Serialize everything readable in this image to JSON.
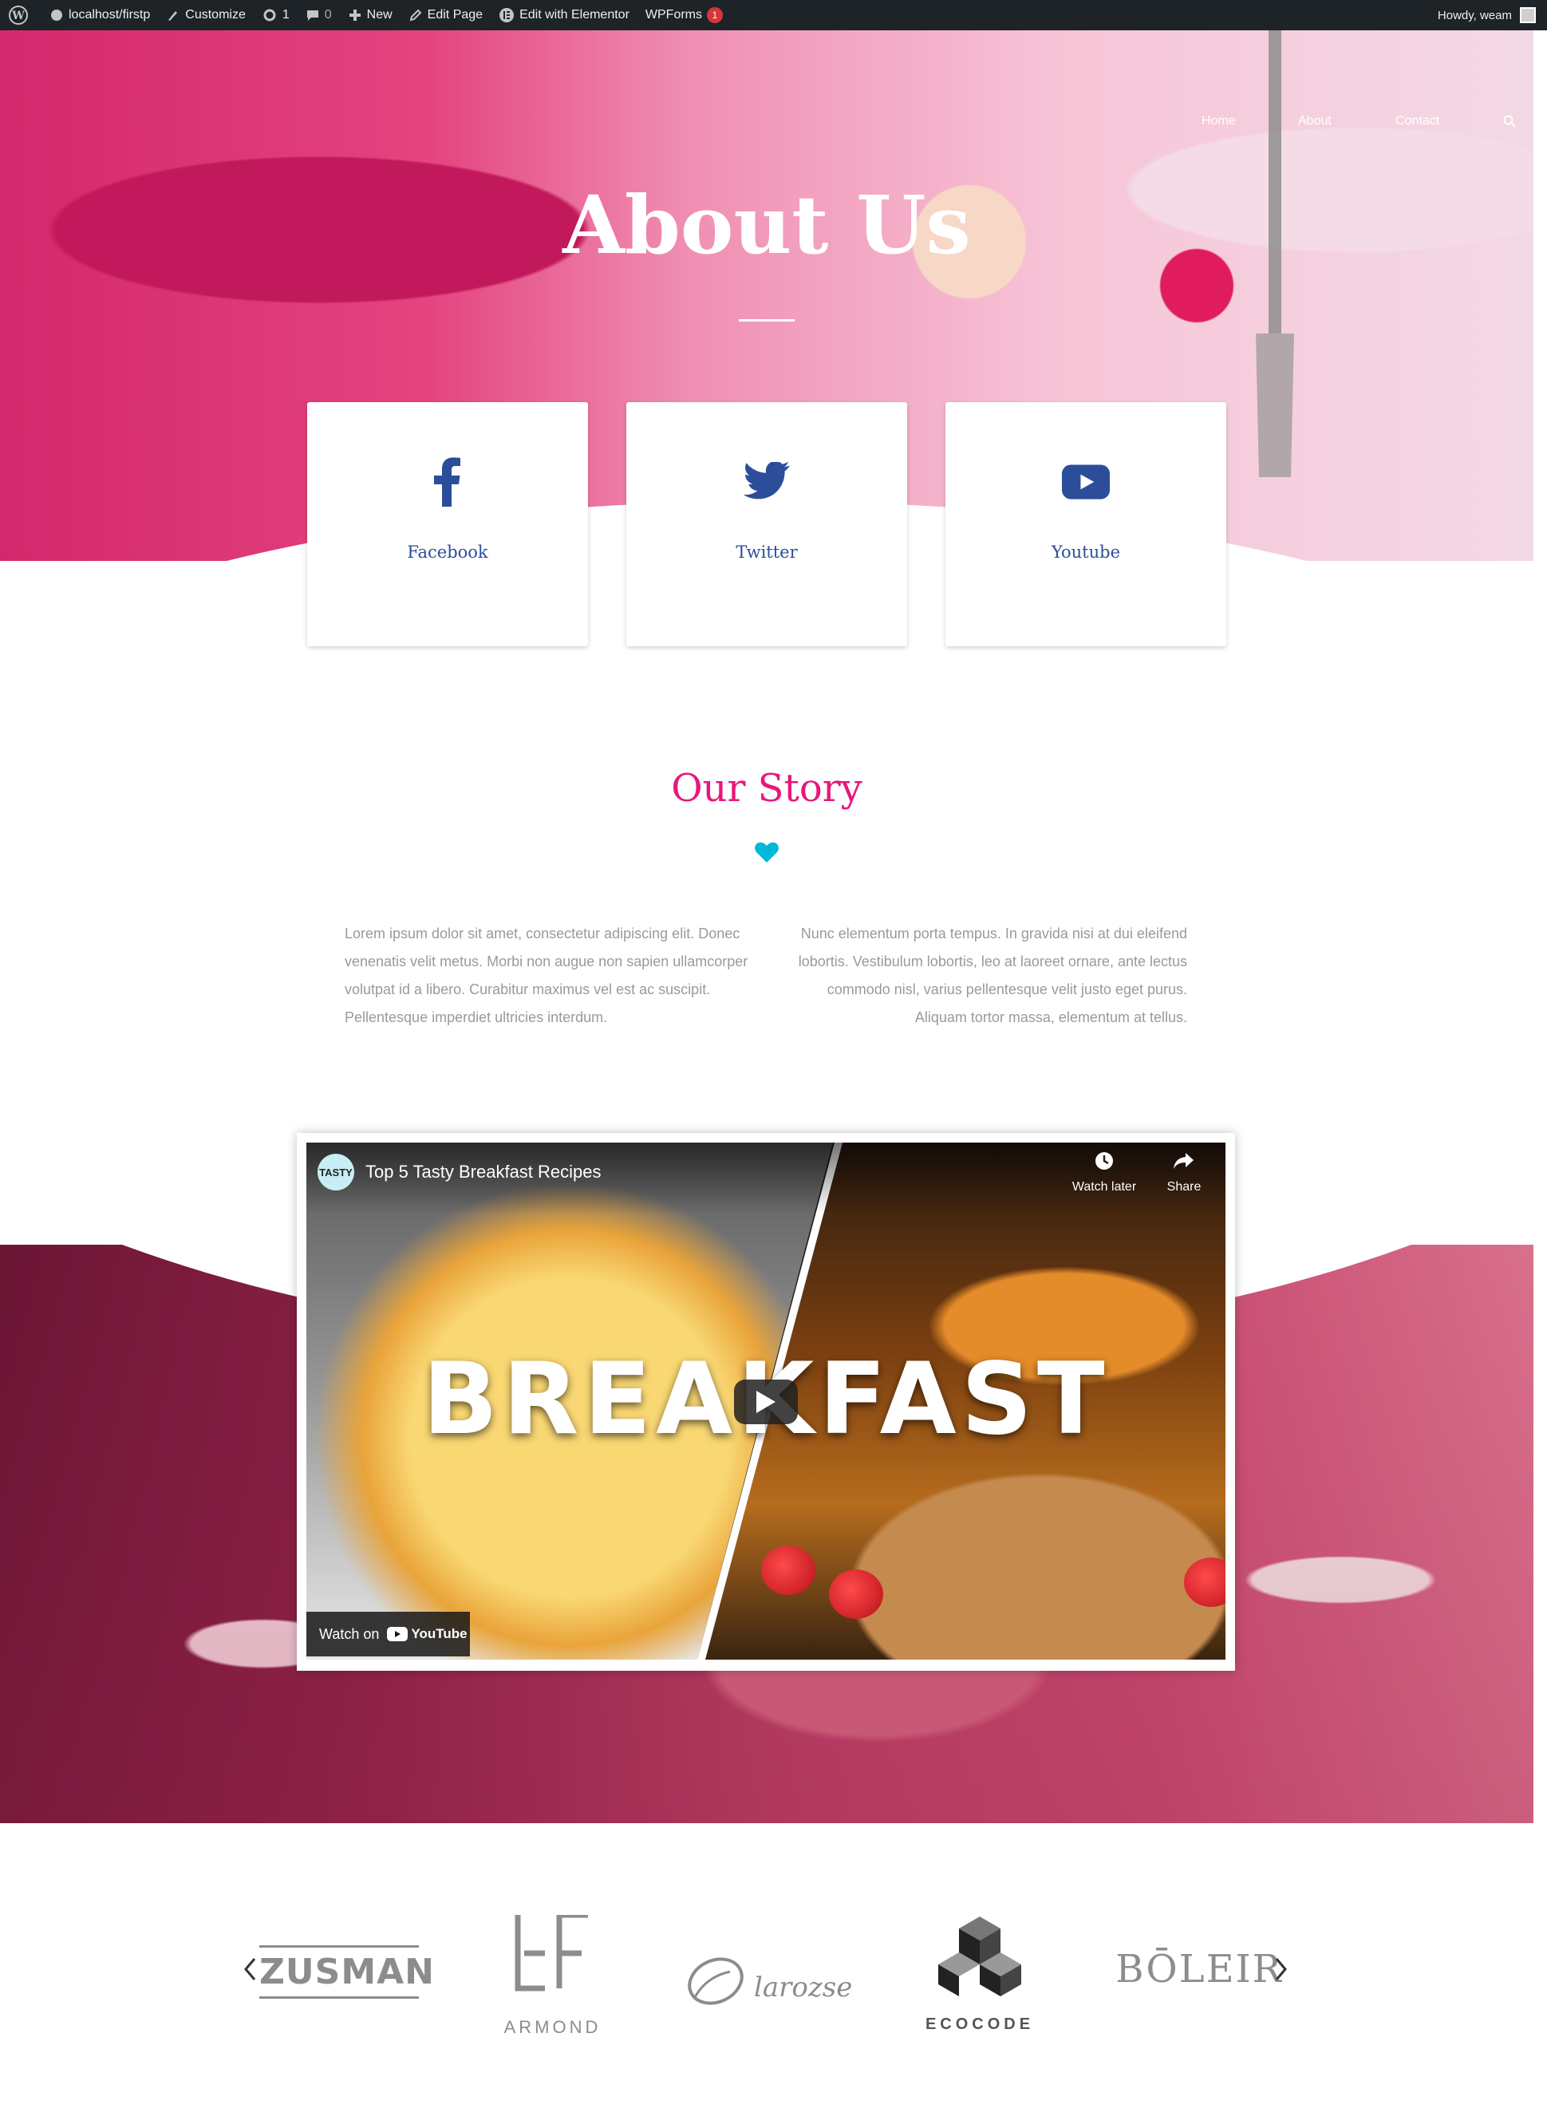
{
  "admin_bar": {
    "site": "localhost/firstp",
    "customize": "Customize",
    "updates_count": "1",
    "comments_count": "0",
    "new": "New",
    "edit_page": "Edit Page",
    "edit_elementor": "Edit with Elementor",
    "wpforms": "WPForms",
    "wpforms_badge": "1",
    "howdy": "Howdy, weam"
  },
  "nav": {
    "items": [
      "Home",
      "About",
      "Contact"
    ]
  },
  "hero": {
    "title": "About Us"
  },
  "social": [
    {
      "label": "Facebook",
      "icon": "facebook-icon"
    },
    {
      "label": "Twitter",
      "icon": "twitter-icon"
    },
    {
      "label": "Youtube",
      "icon": "youtube-icon"
    }
  ],
  "story": {
    "title": "Our Story",
    "left_text": "Lorem ipsum dolor sit amet, consectetur adipiscing elit. Donec venenatis velit metus. Morbi non augue non sapien ullamcorper volutpat id a libero. Curabitur maximus vel est ac suscipit. Pellentesque imperdiet ultricies interdum.",
    "right_text": "Nunc elementum porta tempus. In gravida nisi at dui eleifend lobortis. Vestibulum lobortis, leo at laoreet ornare, ante lectus commodo nisl, varius pellentesque velit justo eget purus. Aliquam tortor massa, elementum at tellus."
  },
  "video": {
    "channel": "TASTY",
    "title": "Top 5 Tasty Breakfast Recipes",
    "watch_later": "Watch later",
    "share": "Share",
    "overlay_text": "BREAKFAST",
    "watch_on": "Watch on",
    "youtube": "YouTube"
  },
  "logos": [
    "ZUSMAN",
    "ARMOND",
    "larozse",
    "ECOCODE",
    "BŌLEIR"
  ],
  "colors": {
    "admin_bg": "#1d2327",
    "accent_pink": "#e8177b",
    "link_blue": "#2b4d9a",
    "heart": "#00b8d8"
  }
}
